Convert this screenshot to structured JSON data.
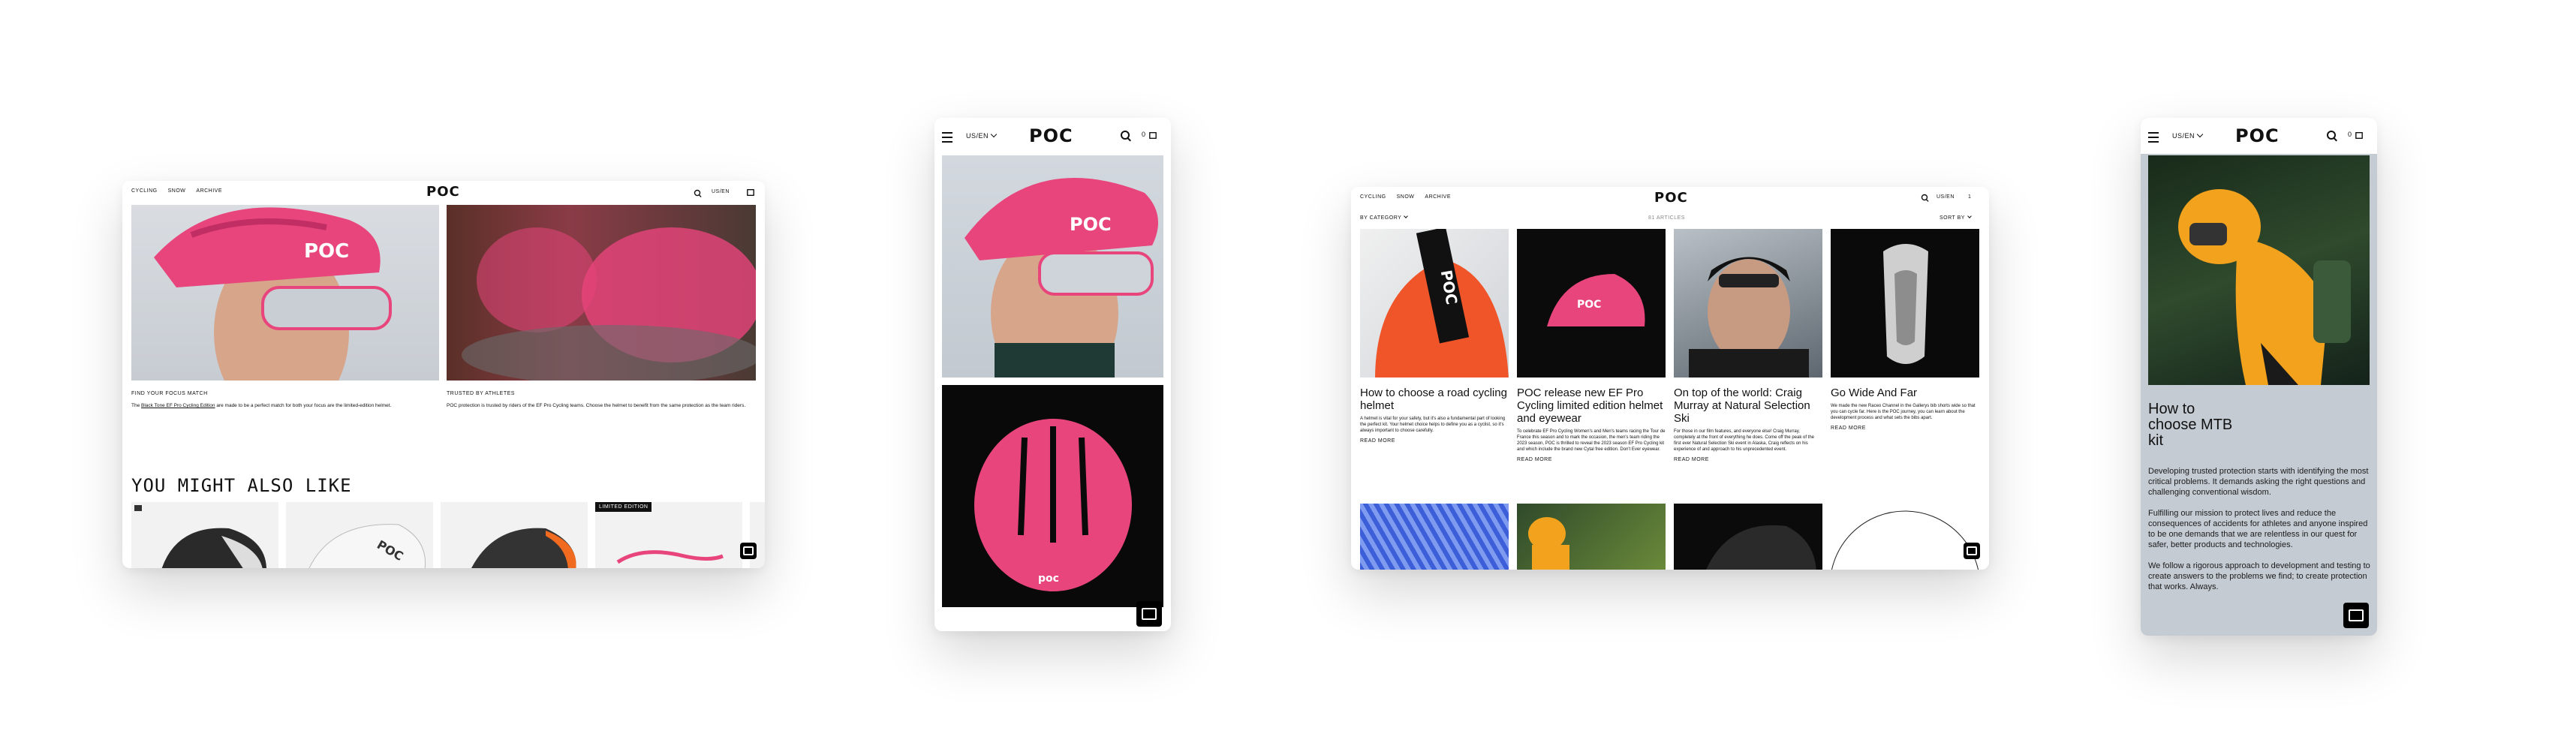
{
  "desktop1": {
    "nav": [
      "CYCLING",
      "SNOW",
      "ARCHIVE"
    ],
    "logo": "POC",
    "locale": "US/EN",
    "cart": "0",
    "card1": {
      "title": "FIND YOUR FOCUS MATCH",
      "body_prefix": "The ",
      "body_link": "Black Tone EF Pro Cycling Edition",
      "body_suffix": " are made to be a perfect match for both your focus are the limited-edition helmet."
    },
    "card2": {
      "title": "TRUSTED BY ATHLETES",
      "body": "POC protection is trusted by riders of the EF Pro Cycling teams. Choose the helmet to benefit from the same protection as the team riders."
    },
    "section_title": "YOU MIGHT ALSO LIKE",
    "badge": "LIMITED EDITION"
  },
  "mobile1": {
    "locale": "US/EN",
    "logo": "POC",
    "cart": "0"
  },
  "desktop2": {
    "nav": [
      "CYCLING",
      "SNOW",
      "ARCHIVE"
    ],
    "logo": "POC",
    "locale": "US/EN",
    "cart": "1",
    "filter_left": "BY CATEGORY",
    "count": "81 ARTICLES",
    "filter_right": "SORT BY",
    "articles": [
      {
        "title": "How to choose a road cycling helmet",
        "body": "A helmet is vital for your safety, but it's also a fundamental part of looking the perfect kit. Your helmet choice helps to define you as a cyclist, so it's always important to choose carefully.",
        "cta": "READ MORE"
      },
      {
        "title": "POC release new EF Pro Cycling limited edition helmet and eyewear",
        "body": "To celebrate EF Pro Cycling Women's and Men's teams racing the Tour de France this season and to mark the occasion, the men's team riding the 2023 season, POC is thrilled to reveal the 2023 season EF Pro Cycling kit and which include the brand new Cytal free edition. Don't Ever eyewear.",
        "cta": "READ MORE"
      },
      {
        "title": "On top of the world: Craig Murray at Natural Selection Ski",
        "body": "For those in our film features, and everyone else! Craig Murray, completely at the front of everything he does. Come off the peak of the first ever Natural Selection Ski event in Alaska, Craig reflects on his experience of and approach to his unprecedented event.",
        "cta": "READ MORE"
      },
      {
        "title": "Go Wide And Far",
        "body": "We made the new Raceo Channel in the Gallerys bib shorts wide so that you can cycle far. Here is the POC journey, you can learn about the development process and what sets the bibs apart.",
        "cta": "READ MORE"
      }
    ]
  },
  "mobile2": {
    "locale": "US/EN",
    "logo": "POC",
    "cart": "0",
    "title": "How to\nchoose MTB\nkit",
    "paragraphs": [
      "Developing trusted protection starts with identifying the most critical problems. It demands asking the right questions and challenging conventional wisdom.",
      "Fulfilling our mission to protect lives and reduce the consequences of accidents for athletes and anyone inspired to be one demands that we are relentless in our quest for safer, better products and technologies.",
      "We follow a rigorous approach to development and testing to create answers to the problems we find; to create protection that works. Always."
    ]
  },
  "colors": {
    "accent_pink": "#e8457c",
    "dark": "#111111",
    "panel_gray": "#c5cbd3"
  }
}
